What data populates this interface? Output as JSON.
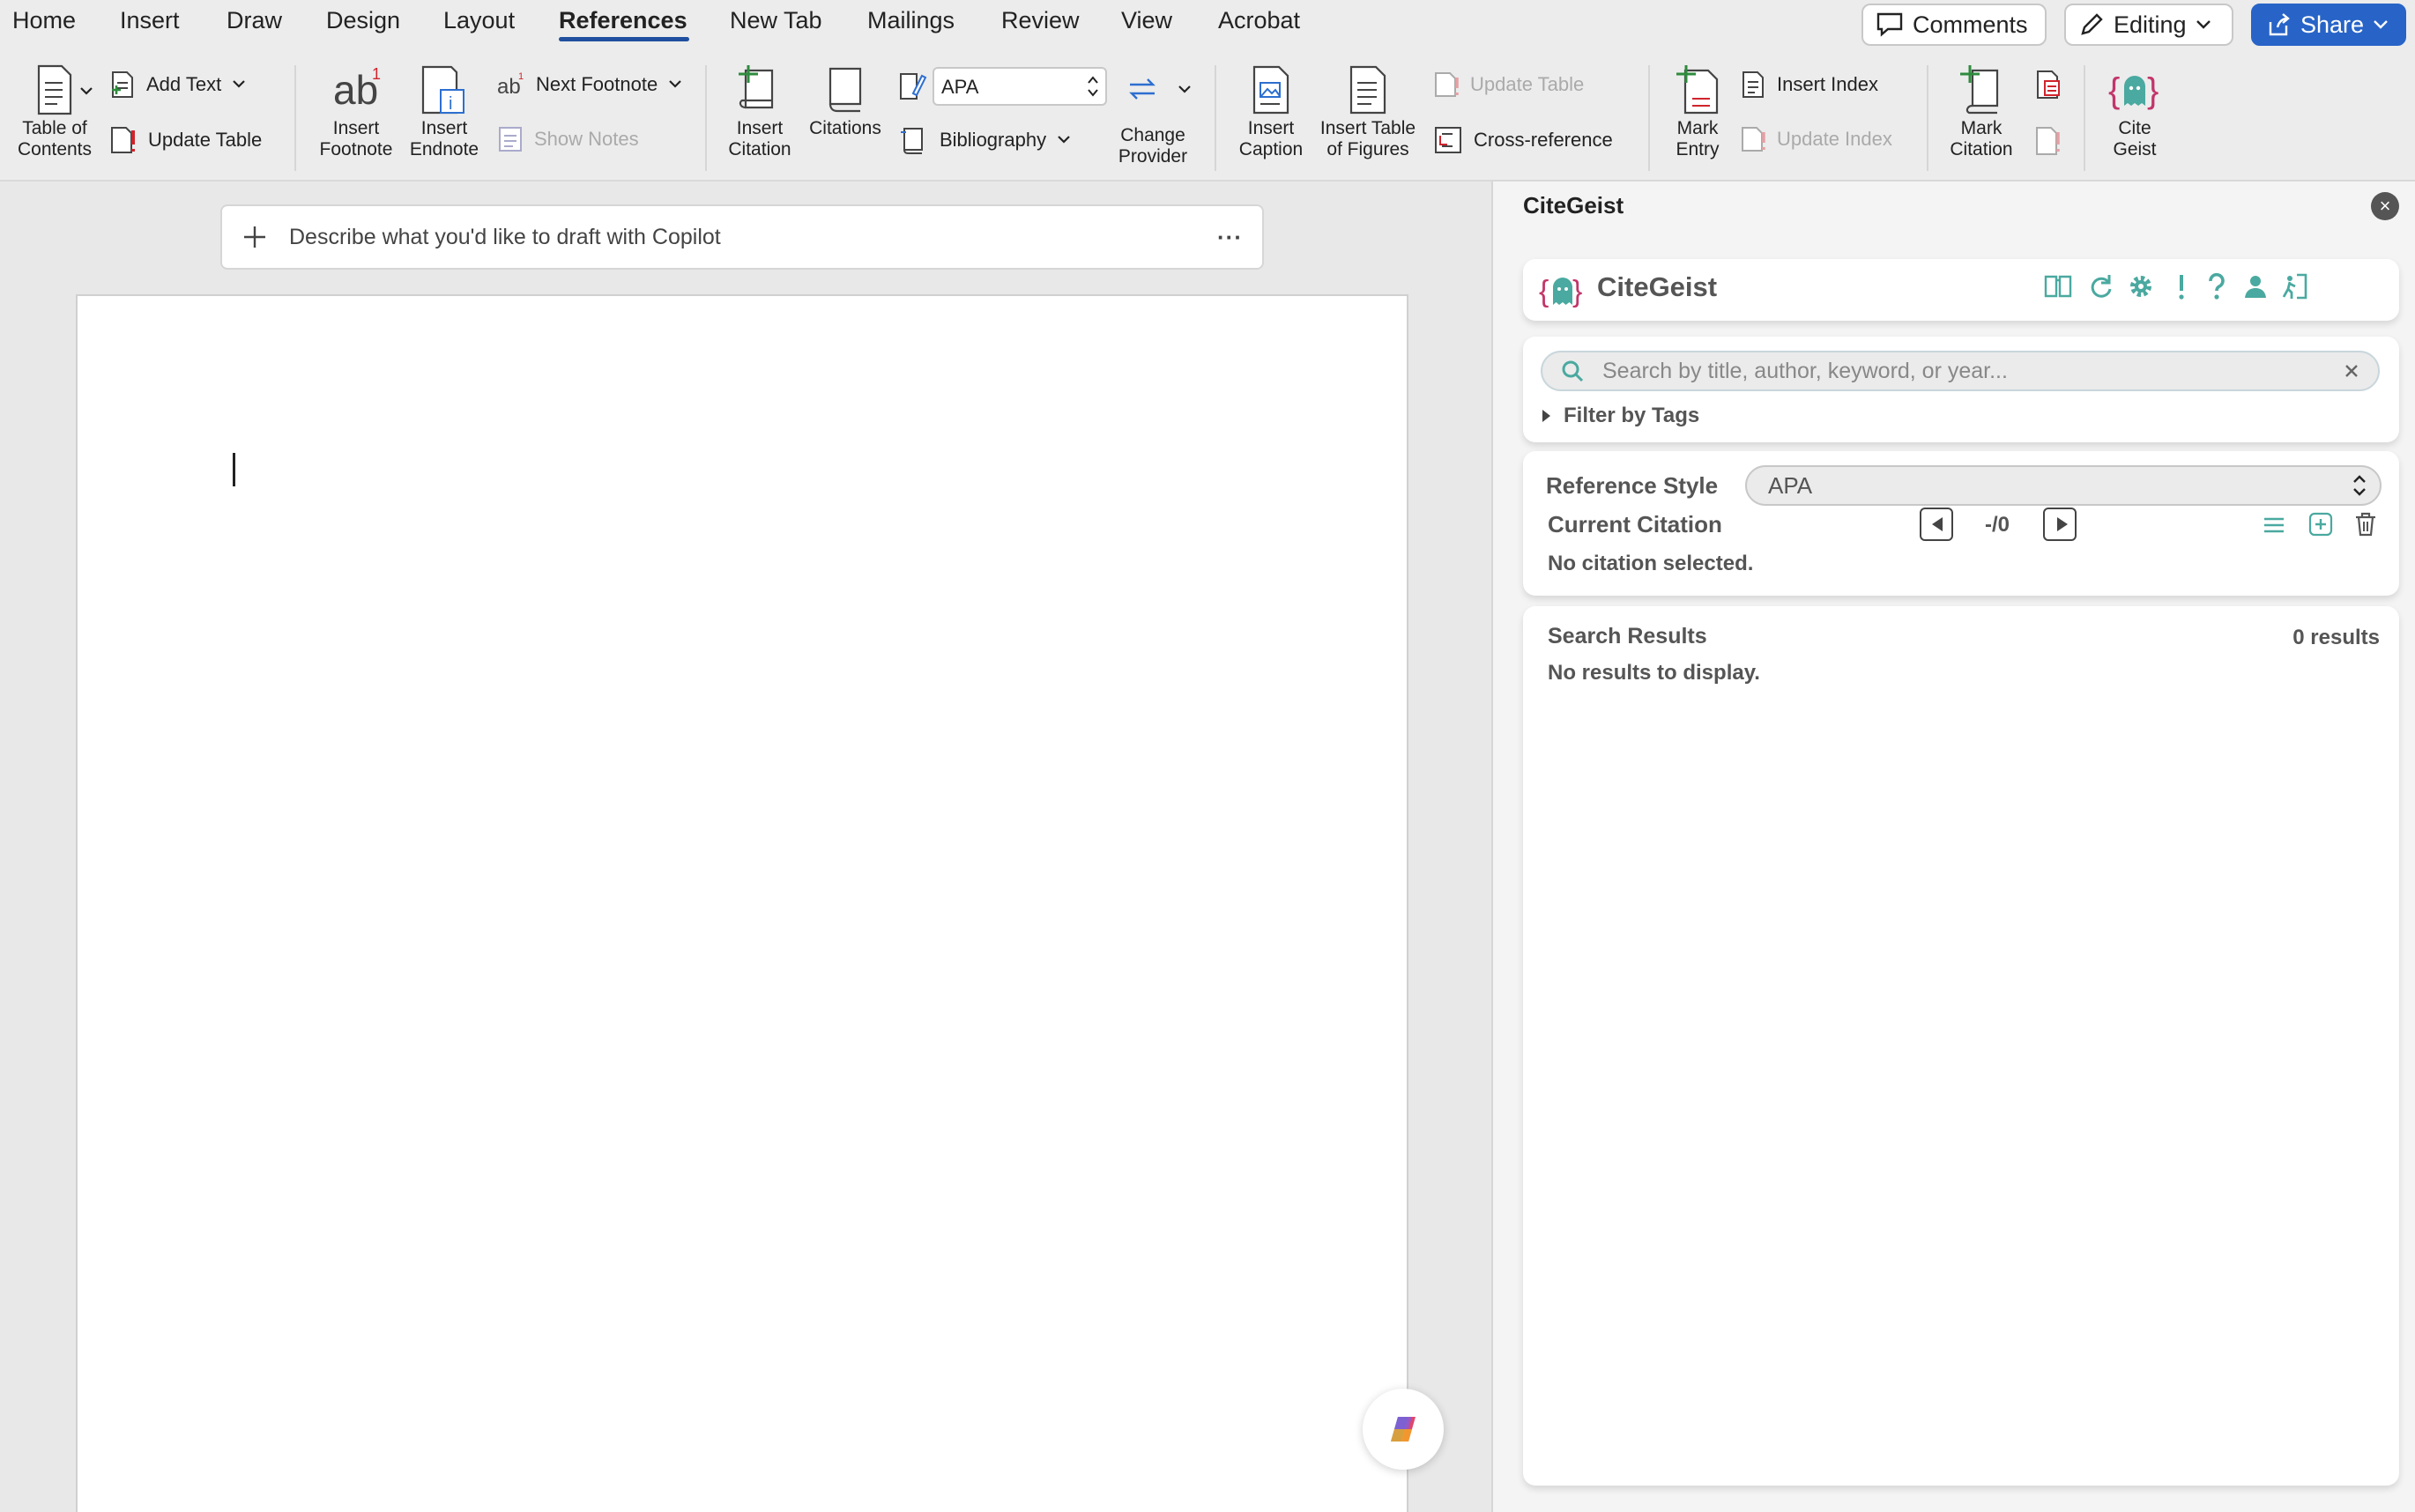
{
  "tabs": [
    "Home",
    "Insert",
    "Draw",
    "Design",
    "Layout",
    "References",
    "New Tab",
    "Mailings",
    "Review",
    "View",
    "Acrobat"
  ],
  "active_tab": "References",
  "top_right": {
    "comments": "Comments",
    "editing": "Editing",
    "share": "Share"
  },
  "ribbon": {
    "toc": [
      "Table of",
      "Contents"
    ],
    "add_text": "Add Text",
    "update_table_toc": "Update Table",
    "insert_footnote": [
      "Insert",
      "Footnote"
    ],
    "insert_endnote": [
      "Insert",
      "Endnote"
    ],
    "next_footnote": "Next Footnote",
    "show_notes": "Show Notes",
    "insert_citation": [
      "Insert",
      "Citation"
    ],
    "citations": "Citations",
    "style_value": "APA",
    "bibliography": "Bibliography",
    "change_provider": [
      "Change",
      "Provider"
    ],
    "insert_caption": [
      "Insert",
      "Caption"
    ],
    "insert_table_figures": [
      "Insert Table",
      "of Figures"
    ],
    "update_table_captions": "Update Table",
    "cross_reference": "Cross-reference",
    "mark_entry": [
      "Mark",
      "Entry"
    ],
    "insert_index": "Insert Index",
    "update_index": "Update Index",
    "mark_citation": [
      "Mark",
      "Citation"
    ],
    "cite_geist": [
      "Cite",
      "Geist"
    ]
  },
  "document": {
    "copilot_placeholder": "Describe what you'd like to draft with Copilot",
    "copilot_more": "···"
  },
  "pane": {
    "title": "CiteGeist",
    "close": "×",
    "app_name": "CiteGeist",
    "toolbar_icons": [
      "library-icon",
      "refresh-icon",
      "settings-icon",
      "alert-icon",
      "help-icon",
      "user-icon",
      "exit-icon"
    ],
    "search_placeholder": "Search by title, author, keyword, or year...",
    "filter_by_tags": "Filter by Tags",
    "reference_style_label": "Reference Style",
    "reference_style_value": "APA",
    "current_citation_label": "Current Citation",
    "citation_counter": "-/0",
    "no_citation": "No citation selected.",
    "search_results_label": "Search Results",
    "results_count": "0 results",
    "no_results": "No results to display."
  },
  "colors": {
    "accent_blue": "#2864c7",
    "teal": "#4aa9a0",
    "pink": "#c2356a"
  }
}
